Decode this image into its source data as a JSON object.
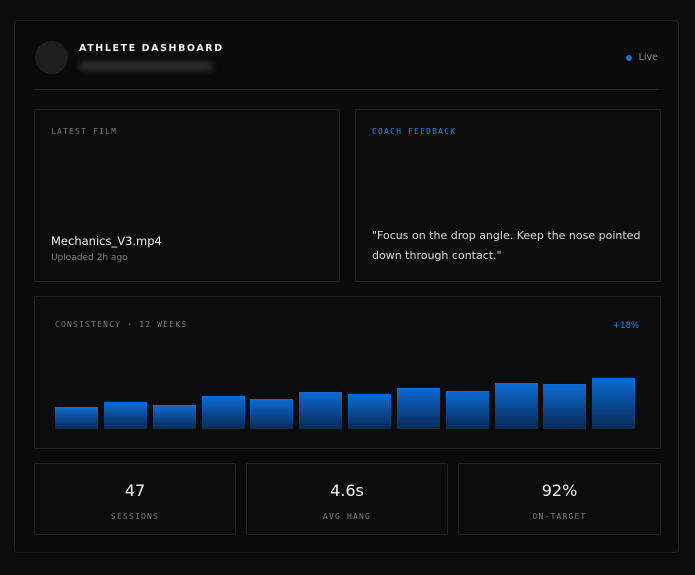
{
  "header": {
    "title": "ATHLETE DASHBOARD",
    "status": "Live",
    "status_color": "#1f6fd1",
    "avatar_icon": "avatar"
  },
  "film": {
    "label": "LATEST FILM",
    "file_name": "Mechanics_V3.mp4",
    "meta": "Uploaded 2h ago"
  },
  "feedback": {
    "label": "COACH FEEDBACK",
    "quote": "\"Focus on the drop angle. Keep the nose pointed down through contact.\""
  },
  "consistency": {
    "label": "CONSISTENCY · 12 WEEKS",
    "delta": "+18%"
  },
  "chart_data": {
    "type": "bar",
    "categories": [
      "",
      "",
      "",
      "",
      "",
      "",
      "",
      "",
      "",
      "",
      "",
      ""
    ],
    "values": [
      22,
      27,
      24,
      33,
      30,
      37,
      35,
      41,
      38,
      46,
      45,
      51
    ],
    "ylim": [
      0,
      62
    ],
    "accent": "#0d6cd3"
  },
  "stats": [
    {
      "value": "47",
      "label": "SESSIONS"
    },
    {
      "value": "4.6s",
      "label": "AVG HANG"
    },
    {
      "value": "92%",
      "label": "ON-TARGET"
    }
  ]
}
